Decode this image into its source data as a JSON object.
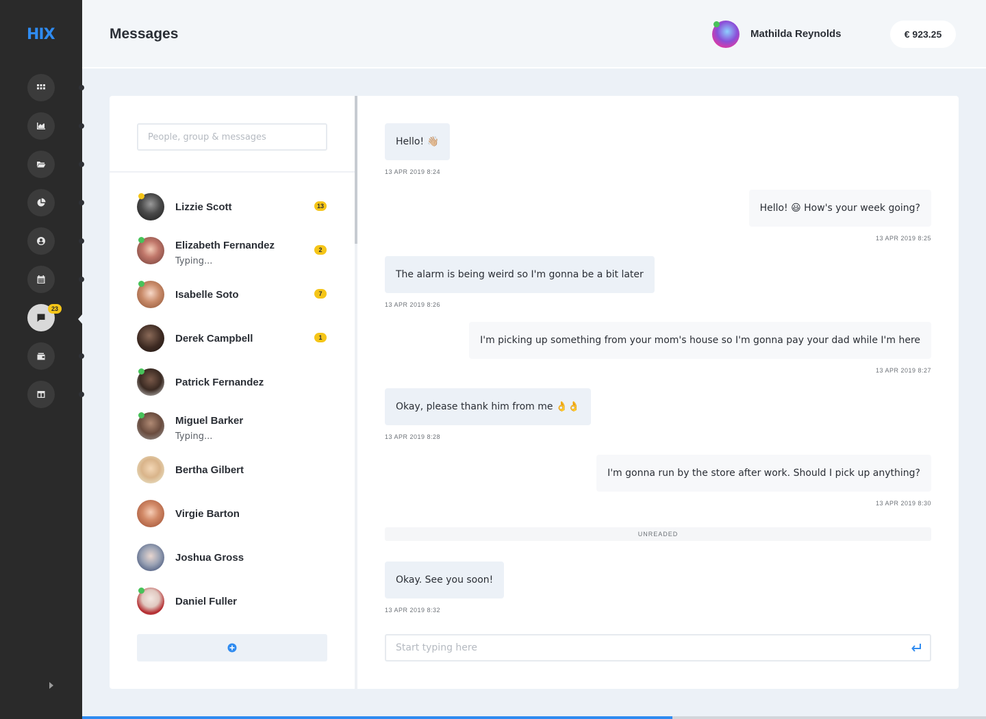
{
  "app": {
    "logo": "HIX",
    "title": "Messages"
  },
  "nav": {
    "items": [
      {
        "name": "nav-dashboard",
        "icon": "grid-icon"
      },
      {
        "name": "nav-analytics",
        "icon": "chart-icon"
      },
      {
        "name": "nav-files",
        "icon": "folder-icon"
      },
      {
        "name": "nav-reports",
        "icon": "pie-chart-icon"
      },
      {
        "name": "nav-profile",
        "icon": "user-icon"
      },
      {
        "name": "nav-calendar",
        "icon": "calendar-icon"
      },
      {
        "name": "nav-messages",
        "icon": "chat-icon",
        "active": true
      },
      {
        "name": "nav-wallet",
        "icon": "wallet-icon"
      },
      {
        "name": "nav-layout",
        "icon": "layout-icon"
      }
    ],
    "messages_badge": "23"
  },
  "user": {
    "name": "Mathilda Reynolds",
    "status": "online",
    "balance": "€  923.25"
  },
  "search": {
    "placeholder": "People, group & messages"
  },
  "contacts": [
    {
      "name": "Lizzie Scott",
      "status_text": "",
      "unread": "13",
      "presence": "away"
    },
    {
      "name": "Elizabeth Fernandez",
      "status_text": "Typing...",
      "unread": "2",
      "presence": "online"
    },
    {
      "name": "Isabelle Soto",
      "status_text": "",
      "unread": "7",
      "presence": "online"
    },
    {
      "name": "Derek Campbell",
      "status_text": "",
      "unread": "1",
      "presence": "none"
    },
    {
      "name": "Patrick Fernandez",
      "status_text": "",
      "unread": "",
      "presence": "online"
    },
    {
      "name": "Miguel Barker",
      "status_text": "Typing...",
      "unread": "",
      "presence": "online"
    },
    {
      "name": "Bertha Gilbert",
      "status_text": "",
      "unread": "",
      "presence": "none"
    },
    {
      "name": "Virgie Barton",
      "status_text": "",
      "unread": "",
      "presence": "none"
    },
    {
      "name": "Joshua Gross",
      "status_text": "",
      "unread": "",
      "presence": "none"
    },
    {
      "name": "Daniel Fuller",
      "status_text": "",
      "unread": "",
      "presence": "online"
    }
  ],
  "messages": [
    {
      "direction": "in",
      "text": "Hello! 👋🏼",
      "time": "13 APR 2019 8:24"
    },
    {
      "direction": "out",
      "text": "Hello! 😃 How's your week going?",
      "time": "13 APR 2019 8:25"
    },
    {
      "direction": "in",
      "text": "The alarm is being weird so I'm gonna be a bit later",
      "time": "13 APR 2019 8:26"
    },
    {
      "direction": "out",
      "text": "I'm picking up something from your mom's house so I'm gonna pay your dad while I'm here",
      "time": "13 APR 2019 8:27"
    },
    {
      "direction": "in",
      "text": "Okay, please thank him from me 👌👌",
      "time": "13 APR 2019 8:28"
    },
    {
      "direction": "out",
      "text": "I'm gonna run by the store after work. Should I pick up anything?",
      "time": "13 APR 2019 8:30"
    },
    {
      "direction": "in",
      "text": "Okay. See you soon!",
      "time": "13 APR 2019 8:32"
    }
  ],
  "unread_divider": "UNREADED",
  "compose": {
    "placeholder": "Start typing here",
    "value": ""
  },
  "progress": 0.653,
  "colors": {
    "accent": "#2f8bf0",
    "sidebar": "#2a2a2a",
    "badge": "#f5c518",
    "online": "#48c25a",
    "bubble_in": "#ecf1f7",
    "bubble_out": "#f7f8fa"
  }
}
